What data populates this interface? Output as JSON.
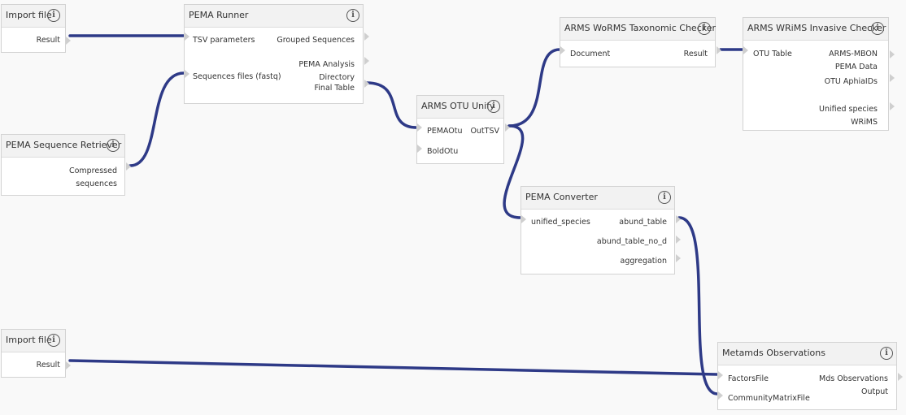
{
  "nodes": {
    "import_file_1": {
      "title": "Import file",
      "outputs": [
        "Result"
      ]
    },
    "pema_runner": {
      "title": "PEMA Runner",
      "inputs": [
        "TSV parameters",
        "Sequences files (fastq)"
      ],
      "outputs": [
        "Grouped Sequences",
        "PEMA Analysis",
        "Directory",
        "Final Table"
      ]
    },
    "pema_sequence_retriever": {
      "title": "PEMA Sequence Retriever",
      "outputs": [
        "Compressed",
        "sequences"
      ]
    },
    "arms_otu_unify": {
      "title": "ARMS OTU Unify",
      "inputs": [
        "PEMAOtu",
        "BoldOtu"
      ],
      "outputs": [
        "OutTSV"
      ]
    },
    "arms_worms_checker": {
      "title": "ARMS WoRMS Taxonomic Checker",
      "inputs": [
        "Document"
      ],
      "outputs": [
        "Result"
      ]
    },
    "arms_wrims_checker": {
      "title": "ARMS WRiMS Invasive Checker",
      "inputs": [
        "OTU Table"
      ],
      "outputs": [
        "ARMS-MBON",
        "PEMA Data",
        "OTU AphiaIDs",
        "Unified species",
        "WRiMS"
      ]
    },
    "pema_converter": {
      "title": "PEMA Converter",
      "inputs": [
        "unified_species"
      ],
      "outputs": [
        "abund_table",
        "abund_table_no_d",
        "aggregation"
      ]
    },
    "import_file_2": {
      "title": "Import file",
      "outputs": [
        "Result"
      ]
    },
    "metamds_observations": {
      "title": "Metamds Observations",
      "inputs": [
        "FactorsFile",
        "CommunityMatrixFile"
      ],
      "outputs": [
        "Mds Observations",
        "Output"
      ]
    }
  },
  "icons": {
    "info": "info-icon",
    "info_glyph": "i"
  },
  "colors": {
    "wire": "#2e3a87",
    "canvas": "#f9f9f9",
    "header": "#f2f2f2",
    "port_marker": "#cfcfcf"
  }
}
